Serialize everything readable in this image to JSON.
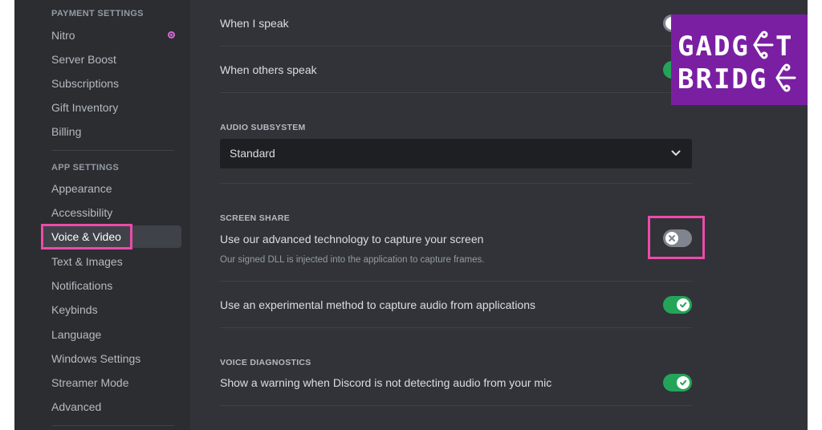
{
  "sidebar": {
    "payment_header": "PAYMENT SETTINGS",
    "payment_items": [
      "Nitro",
      "Server Boost",
      "Subscriptions",
      "Gift Inventory",
      "Billing"
    ],
    "app_header": "APP SETTINGS",
    "app_items": [
      "Appearance",
      "Accessibility",
      "Voice & Video",
      "Text & Images",
      "Notifications",
      "Keybinds",
      "Language",
      "Windows Settings",
      "Streamer Mode",
      "Advanced"
    ],
    "active_item": "Voice & Video"
  },
  "main": {
    "when_i_speak": "When I speak",
    "when_others_speak": "When others speak",
    "audio_subsystem_header": "AUDIO SUBSYSTEM",
    "audio_subsystem_value": "Standard",
    "screen_share_header": "SCREEN SHARE",
    "screen_share_title": "Use our advanced technology to capture your screen",
    "screen_share_note": "Our signed DLL is injected into the application to capture frames.",
    "screen_share_enabled": false,
    "experimental_audio_title": "Use an experimental method to capture audio from applications",
    "experimental_audio_enabled": true,
    "voice_diag_header": "VOICE DIAGNOSTICS",
    "voice_diag_title": "Show a warning when Discord is not detecting audio from your mic",
    "voice_diag_enabled": true
  },
  "watermark": {
    "line1": "GADG",
    "line2": "BRIDG"
  },
  "colors": {
    "highlight": "#ec4ba8",
    "toggle_on": "#23a559",
    "toggle_off": "#80848e",
    "watermark_bg": "#7a1fa2"
  }
}
